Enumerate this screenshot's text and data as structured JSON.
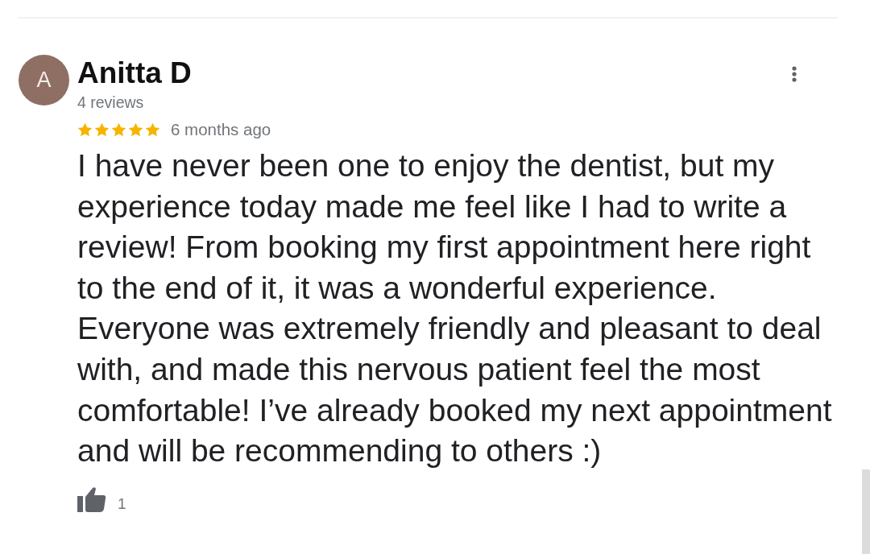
{
  "review": {
    "avatar_letter": "A",
    "author": "Anitta D",
    "author_meta": "4 reviews",
    "stars": 5,
    "time": "6 months ago",
    "text": "I have never been one to enjoy the dentist, but my experience today made me feel like I had to write a review! From booking my first appointment here right to the end of it, it was a wonderful experience. Everyone was extremely friendly and pleasant to deal with, and made this nervous patient feel the most comfortable! I’ve already booked my next appointment and will be recommending to others :)",
    "likes": "1"
  }
}
